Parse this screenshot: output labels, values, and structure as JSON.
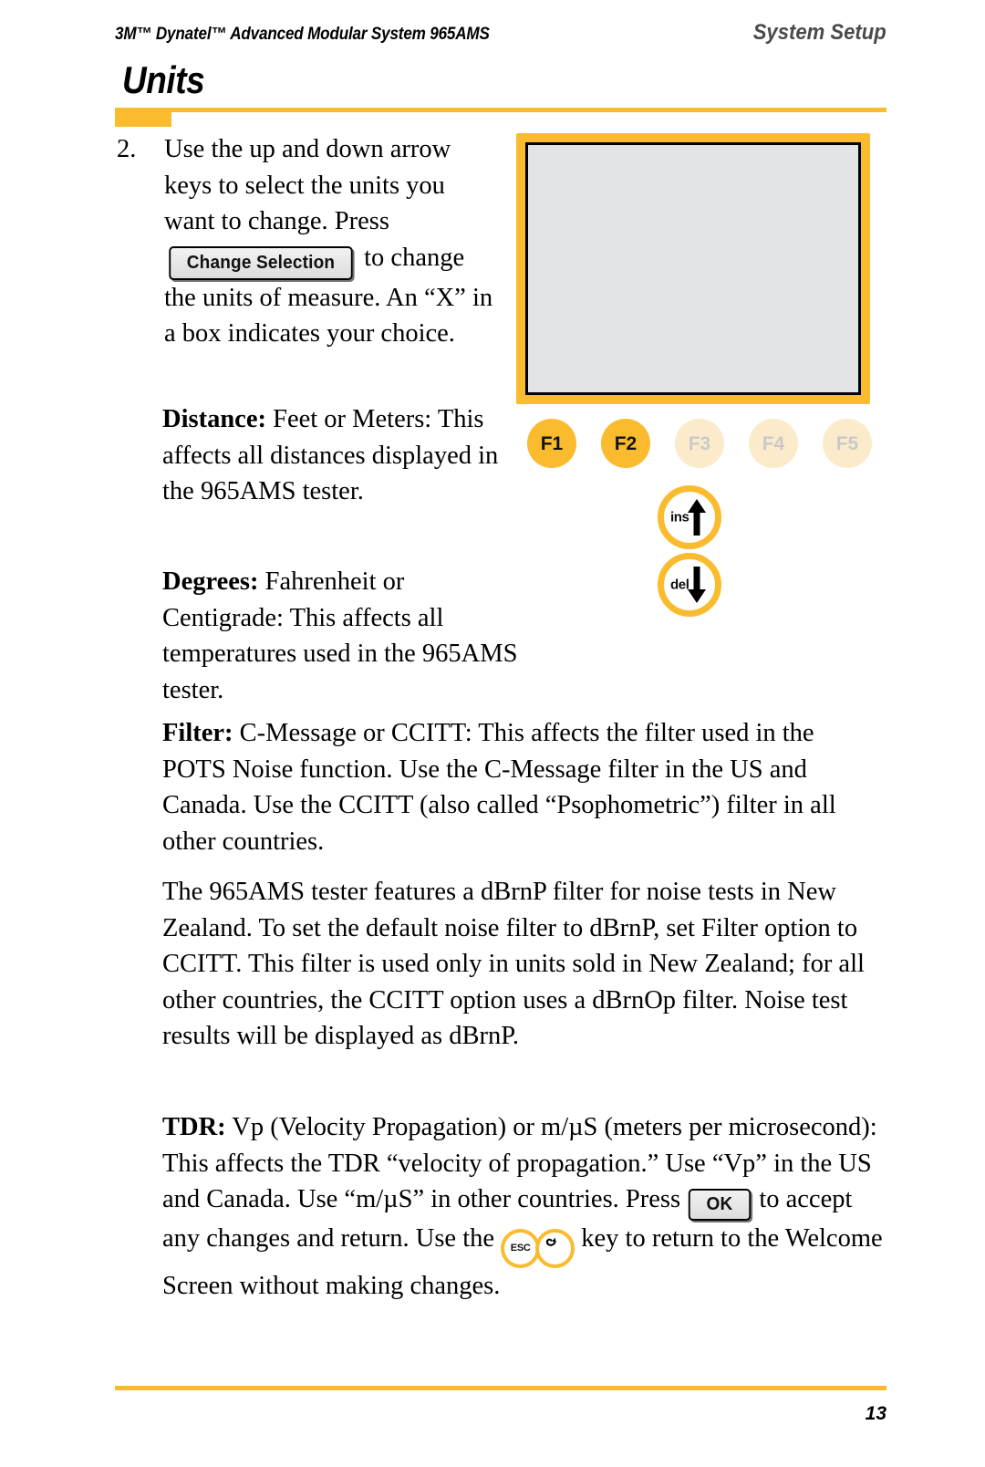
{
  "header": {
    "product_line": "3M™ Dynatel™ Advanced Modular System 965AMS",
    "section": "System Setup"
  },
  "title": "Units",
  "steps": [
    {
      "number": "2.",
      "text_before_button": "Use the up and down arrow keys to select the units you want to change. Press",
      "button_label": "Change Selection",
      "text_after_button": "to change the units of measure. An “X” in a box indicates your choice."
    }
  ],
  "paragraphs": {
    "distance": {
      "lead": "Distance:",
      "body": "Feet or Meters: This affects all distances displayed in the 965AMS tester."
    },
    "degrees": {
      "lead": "Degrees:",
      "body": "Fahrenheit or Centigrade: This affects all temperatures used in the 965AMS tester."
    },
    "filter": {
      "lead": "Filter:",
      "body": "C-Message or CCITT: This affects the filter used in the POTS Noise function. Use the C-Message filter in the US and Canada. Use the CCITT (also called “Psophometric”) filter in all other countries."
    },
    "dbrnp": {
      "body": "The 965AMS tester features a dBrnP filter for noise tests in New Zealand. To set the default noise filter to dBrnP, set Filter option to CCITT. This filter is used only in units sold in New Zealand; for all other countries, the CCITT option uses a dBrnOp filter. Noise test results will be displayed as dBrnP."
    },
    "tdr": {
      "lead": "TDR:",
      "part1": "Vp (Velocity Propagation) or m/µS (meters per microsecond): This affects the TDR “velocity of propagation.” Use “Vp” in the US and Canada. Use “m/µS” in other countries. Press",
      "ok_label": "OK",
      "part2": "to accept any changes and return. Use the",
      "esc_label": "ESC",
      "part3": "key to return to the Welcome Screen without making changes."
    }
  },
  "device": {
    "function_keys": [
      {
        "label": "F1",
        "state": "active"
      },
      {
        "label": "F2",
        "state": "active"
      },
      {
        "label": "F3",
        "state": "dim"
      },
      {
        "label": "F4",
        "state": "dim"
      },
      {
        "label": "F5",
        "state": "dim"
      }
    ],
    "arrow_keys": [
      {
        "label": "ins",
        "direction": "up"
      },
      {
        "label": "del",
        "direction": "down"
      }
    ]
  },
  "footer": {
    "page_number": "13"
  },
  "colors": {
    "accent_yellow": "#FBBB2E",
    "dim_yellow": "#FCEBCB",
    "screen_gray": "#e3e4e6"
  }
}
